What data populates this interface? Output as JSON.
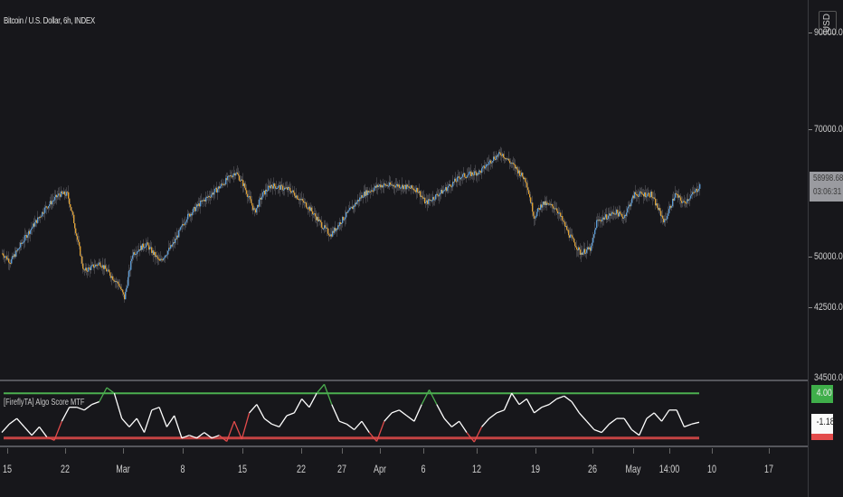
{
  "header": {
    "title": "Bitcoin / U.S. Dollar, 6h, INDEX"
  },
  "colors": {
    "up": "#5b9bd5",
    "down": "#e0a030",
    "score_line": "#ffffff",
    "upper_band": "#4caf50",
    "lower_band": "#e34b4b",
    "background": "#17171b"
  },
  "price_axis": {
    "currency": "USD",
    "labels": [
      "90000.00",
      "70000.00",
      "50000.00",
      "42500.00",
      "34500.00"
    ],
    "last_price": "58998.68",
    "countdown": "03:06:31"
  },
  "indicator": {
    "label": "[FireflyTA] Algo Score MTF",
    "upper": "4.00",
    "current": "-1.18",
    "upper_value": 4,
    "lower_value": -4,
    "scores": [
      -3,
      -1.5,
      -0.5,
      -2,
      -3.5,
      -2,
      -3.8,
      -4.4,
      -1,
      1.5,
      1.5,
      1,
      2,
      2.5,
      5,
      4,
      -0.5,
      -2,
      -0.5,
      -3,
      1,
      1.5,
      -2,
      0,
      -4,
      -3.5,
      -4,
      -3,
      -4,
      -3.5,
      -4.6,
      -1,
      -4.2,
      0.5,
      2,
      -0.5,
      -1.5,
      -2,
      0,
      0.5,
      3,
      1.5,
      4,
      5.6,
      2,
      -1,
      -1.5,
      -2.5,
      -1,
      -3,
      -4.6,
      -1,
      0.5,
      1,
      0,
      -1,
      2,
      4.6,
      2,
      -0.5,
      -2,
      -1,
      -3,
      -4.7,
      -2,
      -0.5,
      0.5,
      1,
      4,
      2,
      3,
      0.5,
      1.5,
      2,
      3,
      3.5,
      2.5,
      0.5,
      -1,
      -2.5,
      -3,
      -1.5,
      -0.5,
      -0.5,
      -2.5,
      -3.5,
      -0.5,
      0.5,
      -1,
      1,
      1,
      -2,
      -1.5,
      -1.18
    ]
  },
  "price_series": {
    "keypoints": [
      [
        0,
        50500
      ],
      [
        3,
        49200
      ],
      [
        9,
        53400
      ],
      [
        16,
        57700
      ],
      [
        21,
        59800
      ],
      [
        24,
        59800
      ],
      [
        26,
        56200
      ],
      [
        30,
        47700
      ],
      [
        36,
        49000
      ],
      [
        43,
        45600
      ],
      [
        45,
        43500
      ],
      [
        48,
        50500
      ],
      [
        53,
        52000
      ],
      [
        58,
        49200
      ],
      [
        63,
        52000
      ],
      [
        68,
        56200
      ],
      [
        73,
        58400
      ],
      [
        79,
        60500
      ],
      [
        84,
        62600
      ],
      [
        86,
        63300
      ],
      [
        89,
        61200
      ],
      [
        93,
        57000
      ],
      [
        96,
        59800
      ],
      [
        99,
        61200
      ],
      [
        106,
        60500
      ],
      [
        113,
        57700
      ],
      [
        118,
        54800
      ],
      [
        121,
        53400
      ],
      [
        126,
        56200
      ],
      [
        133,
        59800
      ],
      [
        139,
        61200
      ],
      [
        146,
        61200
      ],
      [
        153,
        60500
      ],
      [
        156,
        58400
      ],
      [
        163,
        60500
      ],
      [
        169,
        62600
      ],
      [
        176,
        63300
      ],
      [
        181,
        65500
      ],
      [
        184,
        66200
      ],
      [
        189,
        64000
      ],
      [
        193,
        61900
      ],
      [
        196,
        56200
      ],
      [
        199,
        58400
      ],
      [
        204,
        57700
      ],
      [
        209,
        53400
      ],
      [
        213,
        50600
      ],
      [
        217,
        51300
      ],
      [
        219,
        55500
      ],
      [
        226,
        57000
      ],
      [
        229,
        56200
      ],
      [
        233,
        59800
      ],
      [
        239,
        59800
      ],
      [
        244,
        55500
      ],
      [
        248,
        59800
      ],
      [
        251,
        58400
      ],
      [
        256,
        60500
      ],
      [
        257,
        61200
      ]
    ]
  },
  "time_axis": {
    "labels": [
      "15",
      "22",
      "Mar",
      "8",
      "15",
      "22",
      "27",
      "Apr",
      "6",
      "12",
      "19",
      "26",
      "May",
      "14:00",
      "10",
      "17"
    ]
  }
}
